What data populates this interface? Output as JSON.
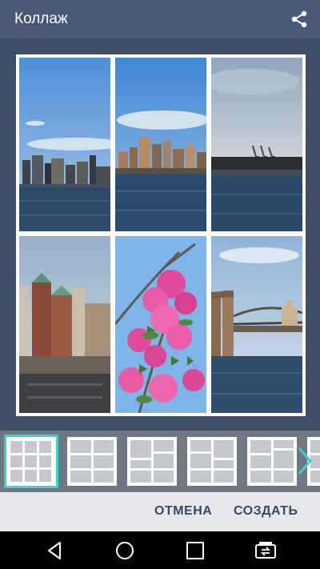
{
  "app": {
    "title": "Коллаж",
    "accent": "#3ad3d0",
    "share_icon": "share-icon"
  },
  "collage": {
    "photos": [
      {
        "id": "photo-1",
        "subject": "city skyline across water"
      },
      {
        "id": "photo-2",
        "subject": "downtown skyline over river"
      },
      {
        "id": "photo-3",
        "subject": "harbor with cranes at dusk"
      },
      {
        "id": "photo-4",
        "subject": "brick buildings and rooftops"
      },
      {
        "id": "photo-5",
        "subject": "pink flowering branch"
      },
      {
        "id": "photo-6",
        "subject": "bridge tower over river"
      }
    ]
  },
  "layouts": {
    "selected_index": 0,
    "next_icon": "chevron-right-icon"
  },
  "actions": {
    "cancel_label": "ОТМЕНА",
    "create_label": "СОЗДАТЬ"
  },
  "navigation": {
    "back_icon": "back-icon",
    "home_icon": "home-icon",
    "recents_icon": "recents-icon",
    "switch_icon": "sim-switch-icon"
  }
}
